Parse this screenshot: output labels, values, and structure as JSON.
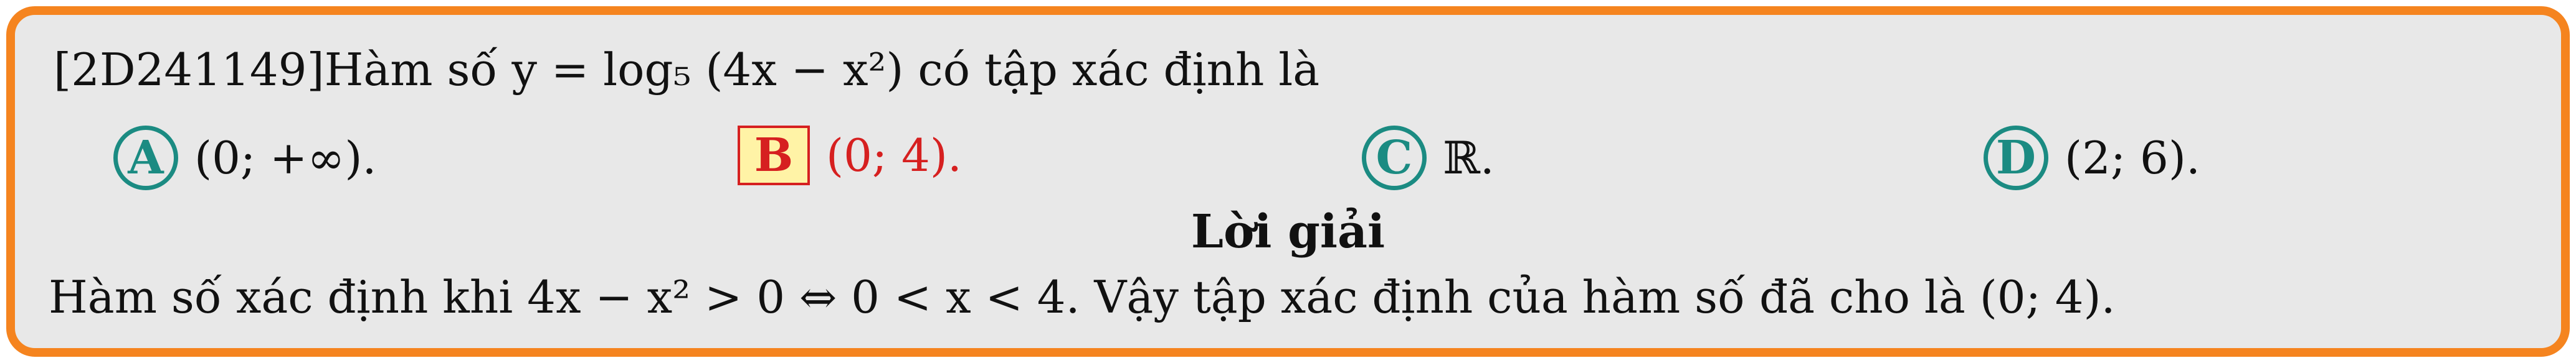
{
  "question": {
    "id": "[2D241149]",
    "text": "Hàm số y = log₅ (4x − x²) có tập xác định là"
  },
  "options": [
    {
      "letter": "A",
      "text": "(0; +∞).",
      "correct": false
    },
    {
      "letter": "B",
      "text": "(0; 4).",
      "correct": true
    },
    {
      "letter": "C",
      "text": "ℝ.",
      "correct": false
    },
    {
      "letter": "D",
      "text": "(2; 6).",
      "correct": false
    }
  ],
  "solution": {
    "title": "Lời giải",
    "text": "Hàm số xác định khi 4x − x² > 0 ⇔ 0 < x < 4. Vậy tập xác định của hàm số đã cho là (0; 4)."
  },
  "colors": {
    "frame_border": "#f5841f",
    "frame_background": "#e8e8e8",
    "option_circle": "#1b8b82",
    "correct_answer": "#d62020",
    "correct_answer_background": "#fff3a6"
  }
}
